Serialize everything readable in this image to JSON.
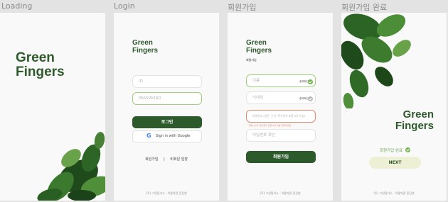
{
  "frames": {
    "loading": "Loading",
    "login": "Login",
    "signup": "회원가입",
    "signup_done": "회원가입 완료"
  },
  "brand": {
    "line1": "Green",
    "line2": "Fingers"
  },
  "login": {
    "id_placeholder": "ID",
    "password_placeholder": "PASSWORD",
    "login_button": "로그인",
    "google_button": "Sign in with Google",
    "signup_link": "회원가입",
    "divider": "|",
    "guest_link": "비회원 입장",
    "footer": "(주) 그린핑거스 · 이용약관 윤진영"
  },
  "signup": {
    "subtitle": "회원가입",
    "email_placeholder": "이름",
    "email_tag": "중복확인",
    "nickname_placeholder": "닉네임",
    "nickname_tag": "중복확인",
    "password_placeholder": "비밀번호 (영문, 숫자, 특수문자 포함 8자 이상)",
    "password_error": "영문, 숫자, 특수문자 포함 8자 이상 입력하세요.",
    "confirm_placeholder": "비밀번호 확인",
    "submit_button": "회원가입",
    "footer": "(주) 그린핑거스 · 이용약관 윤진영"
  },
  "done": {
    "message": "회원가입 완료",
    "next_button": "NEXT",
    "footer": "(주) 그린핑거스 · 이용약관 윤진영"
  },
  "colors": {
    "brand_green": "#2f5a2c",
    "button_green": "#2d5a2b",
    "check_green": "#72b34d",
    "error_red": "#e4896b",
    "next_bg": "#eef0d6"
  }
}
